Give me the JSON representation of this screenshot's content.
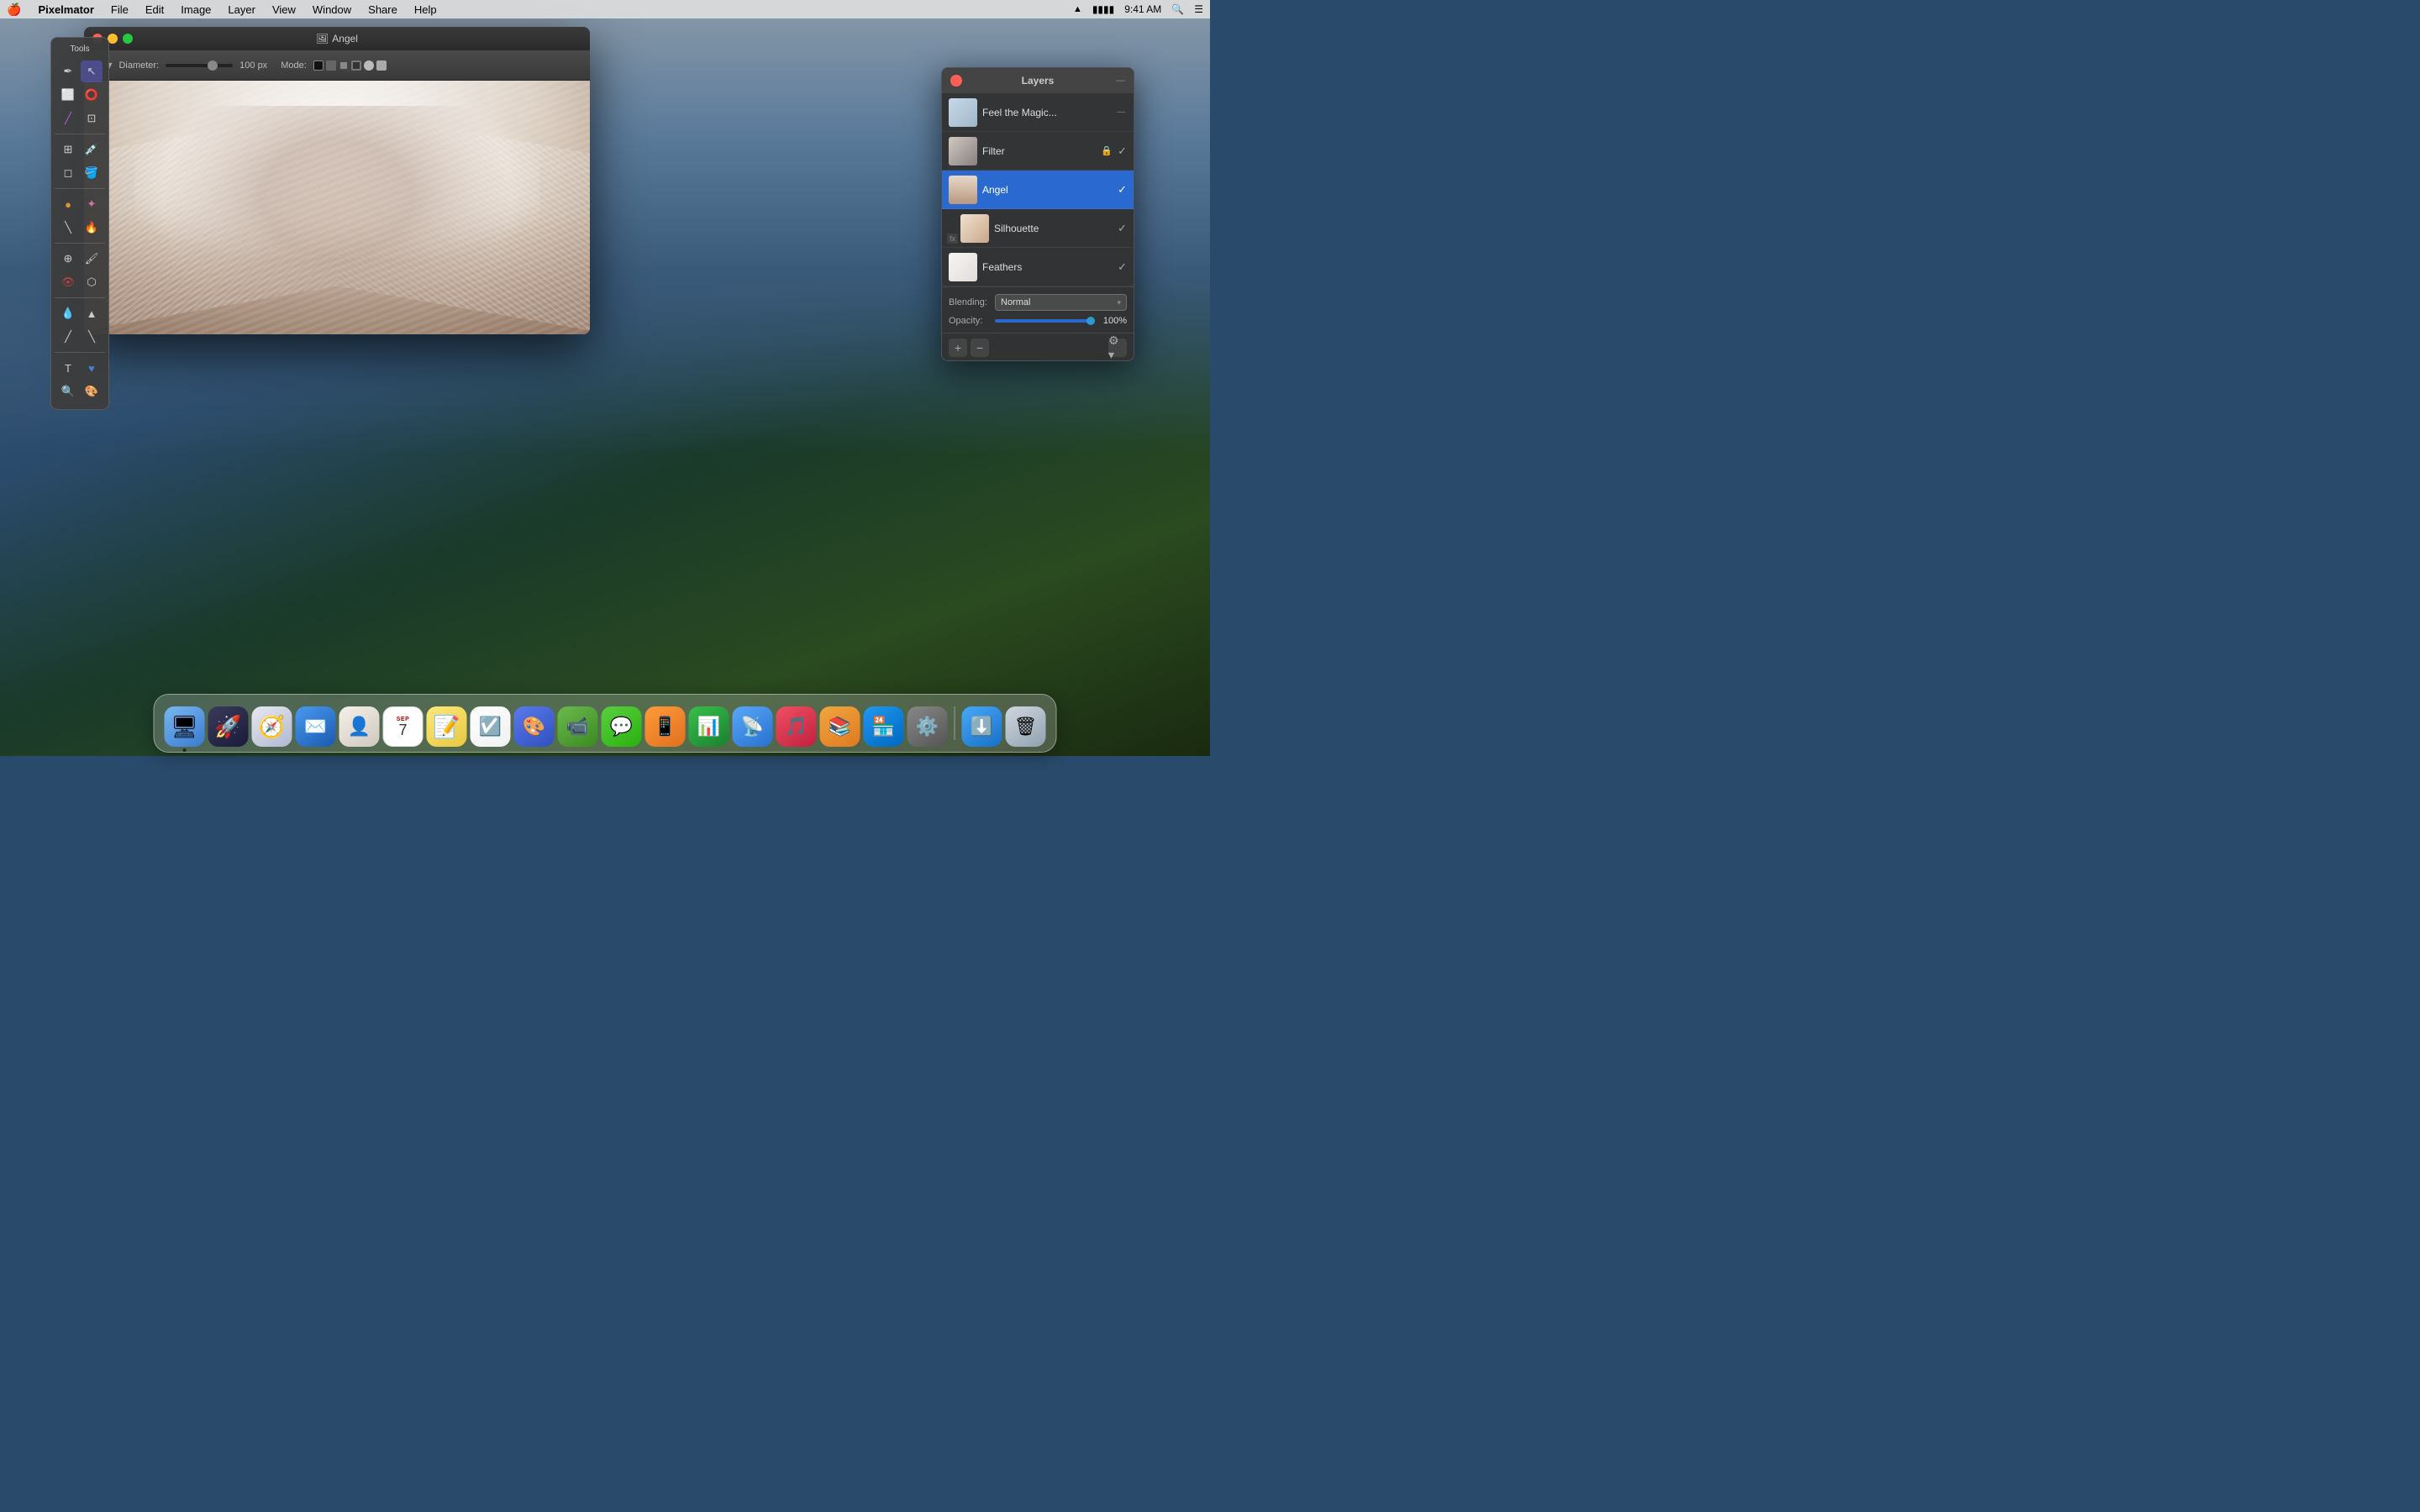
{
  "menubar": {
    "apple": "🍎",
    "app_name": "Pixelmator",
    "menus": [
      "File",
      "Edit",
      "Image",
      "Layer",
      "View",
      "Window",
      "Share",
      "Help"
    ],
    "time": "9:41 AM",
    "wifi": "WiFi",
    "battery": "Battery"
  },
  "tools_panel": {
    "title": "Tools"
  },
  "main_window": {
    "title": "Angel",
    "toolbar": {
      "diameter_label": "Diameter:",
      "diameter_value": "100 px",
      "mode_label": "Mode:"
    }
  },
  "layers_panel": {
    "title": "Layers",
    "layers": [
      {
        "id": "feel",
        "name": "Feel the Magic...",
        "thumb_class": "layer-thumb-feel",
        "selected": false,
        "checked": false,
        "locked": false,
        "fx": false
      },
      {
        "id": "filter",
        "name": "Filter",
        "thumb_class": "layer-thumb-filter",
        "selected": false,
        "checked": true,
        "locked": true,
        "fx": false
      },
      {
        "id": "angel",
        "name": "Angel",
        "thumb_class": "layer-thumb-angel",
        "selected": true,
        "checked": true,
        "locked": false,
        "fx": false
      },
      {
        "id": "silhouette",
        "name": "Silhouette",
        "thumb_class": "layer-thumb-silhouette",
        "selected": false,
        "checked": true,
        "locked": false,
        "fx": true
      },
      {
        "id": "feathers",
        "name": "Feathers",
        "thumb_class": "layer-thumb-feathers",
        "selected": false,
        "checked": true,
        "locked": false,
        "fx": false
      }
    ],
    "blending_label": "Blending:",
    "blending_value": "Normal",
    "opacity_label": "Opacity:",
    "opacity_value": "100%",
    "opacity_percent": 100
  },
  "dock": {
    "apps": [
      {
        "name": "Finder",
        "class": "app-finder",
        "icon": "🖥",
        "running": true
      },
      {
        "name": "Launchpad",
        "class": "app-launchpad",
        "icon": "🚀",
        "running": false
      },
      {
        "name": "Safari",
        "class": "app-safari",
        "icon": "🧭",
        "running": false
      },
      {
        "name": "Mail",
        "class": "app-mail",
        "icon": "✉️",
        "running": false
      },
      {
        "name": "Contacts",
        "class": "app-contacts",
        "icon": "👤",
        "running": false
      },
      {
        "name": "Calendar",
        "class": "app-calendar",
        "icon": "📅",
        "running": false
      },
      {
        "name": "Notes",
        "class": "app-notes",
        "icon": "📝",
        "running": false
      },
      {
        "name": "Reminders",
        "class": "app-reminders",
        "icon": "☑️",
        "running": false
      },
      {
        "name": "FaceTime",
        "class": "app-facetime",
        "icon": "📹",
        "running": false
      },
      {
        "name": "Messages",
        "class": "app-messages",
        "icon": "💬",
        "running": false
      },
      {
        "name": "iPhone Backup",
        "class": "app-iphonebackup",
        "icon": "📱",
        "running": false
      },
      {
        "name": "Numbers",
        "class": "app-numbers",
        "icon": "📊",
        "running": false
      },
      {
        "name": "AirDrop",
        "class": "app-airdrop",
        "icon": "📡",
        "running": false
      },
      {
        "name": "Music",
        "class": "app-music",
        "icon": "🎵",
        "running": false
      },
      {
        "name": "Books",
        "class": "app-books",
        "icon": "📚",
        "running": false
      },
      {
        "name": "App Store",
        "class": "app-appstore",
        "icon": "🏪",
        "running": false
      },
      {
        "name": "System Preferences",
        "class": "app-prefs",
        "icon": "⚙️",
        "running": false
      },
      {
        "name": "AirDrop DL",
        "class": "app-airdropdl",
        "icon": "⬇️",
        "running": false
      },
      {
        "name": "Trash",
        "class": "app-trash",
        "icon": "🗑",
        "running": false
      }
    ]
  }
}
